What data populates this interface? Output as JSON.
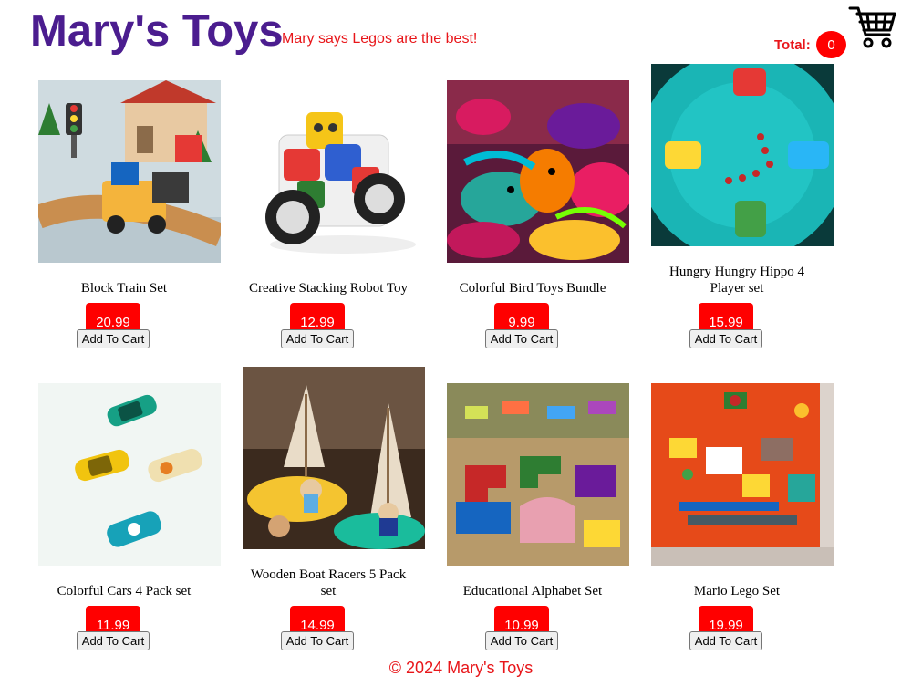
{
  "header": {
    "brand": "Mary's Toys",
    "tagline": "Mary says Legos are the best!",
    "total_label": "Total:",
    "cart_count": "0",
    "cart_icon": "shopping-cart-icon"
  },
  "products": [
    {
      "name": "Block Train Set",
      "price": "20.99",
      "button": "Add To Cart",
      "image": "toy-train-photo"
    },
    {
      "name": "Creative Stacking Robot Toy",
      "price": "12.99",
      "button": "Add To Cart",
      "image": "robot-toy-photo"
    },
    {
      "name": "Colorful Bird Toys Bundle",
      "price": "9.99",
      "button": "Add To Cart",
      "image": "bird-toys-photo"
    },
    {
      "name": "Hungry Hungry Hippo 4 Player set",
      "price": "15.99",
      "button": "Add To Cart",
      "image": "hippo-game-photo"
    },
    {
      "name": "Colorful Cars 4 Pack set",
      "price": "11.99",
      "button": "Add To Cart",
      "image": "toy-cars-photo"
    },
    {
      "name": "Wooden Boat Racers 5 Pack set",
      "price": "14.99",
      "button": "Add To Cart",
      "image": "wooden-boats-photo"
    },
    {
      "name": "Educational Alphabet Set",
      "price": "10.99",
      "button": "Add To Cart",
      "image": "alphabet-puzzle-photo"
    },
    {
      "name": "Mario Lego Set",
      "price": "19.99",
      "button": "Add To Cart",
      "image": "lego-set-photo"
    }
  ],
  "footer": {
    "text": "© 2024 Mary's Toys"
  },
  "colors": {
    "brand": "#4b1d8f",
    "accent": "#e8161a",
    "price_bg": "#ff0000"
  }
}
